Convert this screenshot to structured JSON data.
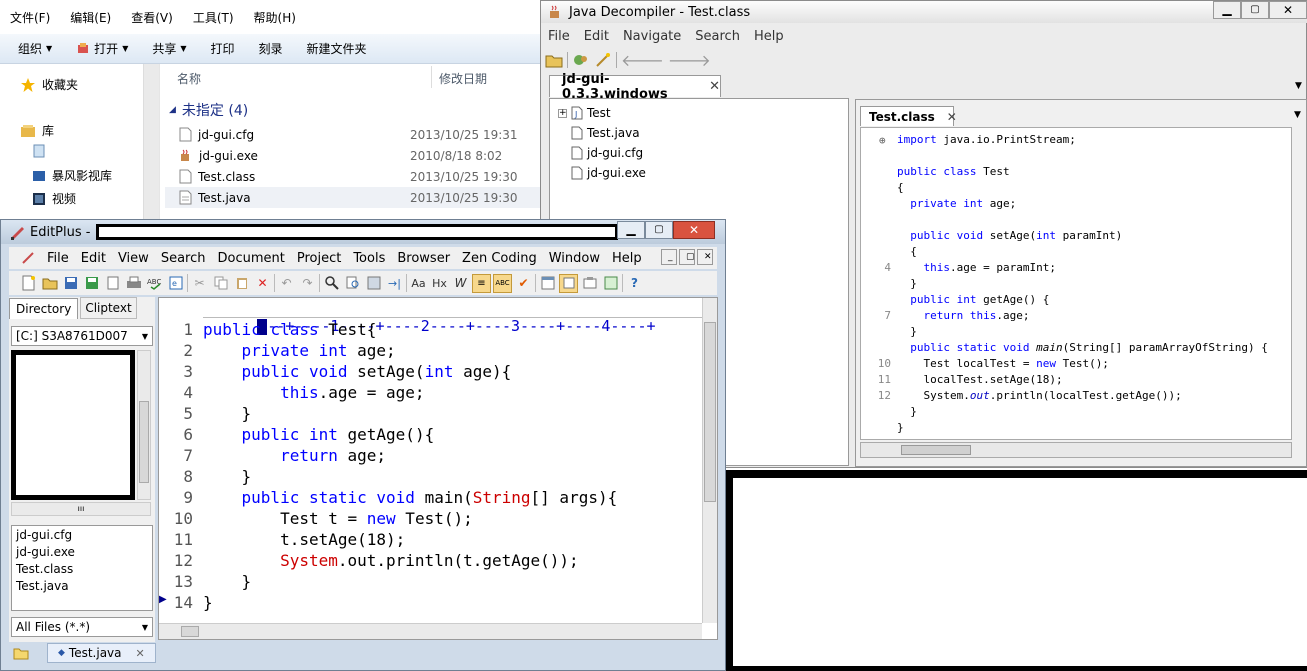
{
  "explorer": {
    "menu": [
      "文件(F)",
      "编辑(E)",
      "查看(V)",
      "工具(T)",
      "帮助(H)"
    ],
    "toolbar": {
      "organize": "组织",
      "open": "打开",
      "share": "共享",
      "print": "打印",
      "burn": "刻录",
      "new_folder": "新建文件夹"
    },
    "nav": {
      "favorites": "收藏夹",
      "library": "库",
      "media": "暴风影视库",
      "video": "视频"
    },
    "columns": {
      "name": "名称",
      "date": "修改日期"
    },
    "group": "未指定 (4)",
    "files": [
      {
        "name": "jd-gui.cfg",
        "date": "2013/10/25 19:31"
      },
      {
        "name": "jd-gui.exe",
        "date": "2010/8/18 8:02"
      },
      {
        "name": "Test.class",
        "date": "2013/10/25 19:30"
      },
      {
        "name": "Test.java",
        "date": "2013/10/25 19:30"
      }
    ]
  },
  "jd": {
    "title": "Java Decompiler - Test.class",
    "menu": [
      "File",
      "Edit",
      "Navigate",
      "Search",
      "Help"
    ],
    "tab": "jd-gui-0.3.3.windows",
    "tree": [
      "Test",
      "Test.java",
      "jd-gui.cfg",
      "jd-gui.exe"
    ],
    "code_tab": "Test.class",
    "code": [
      {
        "n": "",
        "t": "import java.io.PrintStream;"
      },
      {
        "n": "",
        "t": ""
      },
      {
        "n": "",
        "t": "public class Test"
      },
      {
        "n": "",
        "t": "{"
      },
      {
        "n": "",
        "t": "  private int age;"
      },
      {
        "n": "",
        "t": ""
      },
      {
        "n": "",
        "t": "  public void setAge(int paramInt)"
      },
      {
        "n": "",
        "t": "  {"
      },
      {
        "n": "4",
        "t": "    this.age = paramInt;"
      },
      {
        "n": "",
        "t": "  }"
      },
      {
        "n": "",
        "t": "  public int getAge() {"
      },
      {
        "n": "7",
        "t": "    return this.age;"
      },
      {
        "n": "",
        "t": "  }"
      },
      {
        "n": "",
        "t": "  public static void main(String[] paramArrayOfString) {"
      },
      {
        "n": "10",
        "t": "    Test localTest = new Test();"
      },
      {
        "n": "11",
        "t": "    localTest.setAge(18);"
      },
      {
        "n": "12",
        "t": "    System.out.println(localTest.getAge());"
      },
      {
        "n": "",
        "t": "  }"
      },
      {
        "n": "",
        "t": "}"
      }
    ]
  },
  "editplus": {
    "title": "EditPlus -",
    "menu": [
      "File",
      "Edit",
      "View",
      "Search",
      "Document",
      "Project",
      "Tools",
      "Browser",
      "Zen Coding",
      "Window",
      "Help"
    ],
    "tabs": {
      "directory": "Directory",
      "cliptext": "Cliptext"
    },
    "drive": "[C:] S3A8761D007",
    "files": [
      "jd-gui.cfg",
      "jd-gui.exe",
      "Test.class",
      "Test.java"
    ],
    "filter": "All Files (*.*)",
    "doc_tab": "Test.java",
    "ruler": "--+----1----+----2----+----3----+----4----+",
    "code": [
      {
        "n": "1",
        "t": "public class Test{"
      },
      {
        "n": "2",
        "t": "    private int age;"
      },
      {
        "n": "3",
        "t": "    public void setAge(int age){"
      },
      {
        "n": "4",
        "t": "        this.age = age;"
      },
      {
        "n": "5",
        "t": "    }"
      },
      {
        "n": "6",
        "t": "    public int getAge(){"
      },
      {
        "n": "7",
        "t": "        return age;"
      },
      {
        "n": "8",
        "t": "    }"
      },
      {
        "n": "9",
        "t": "    public static void main(String[] args){"
      },
      {
        "n": "10",
        "t": "        Test t = new Test();"
      },
      {
        "n": "11",
        "t": "        t.setAge(18);"
      },
      {
        "n": "12",
        "t": "        System.out.println(t.getAge());"
      },
      {
        "n": "13",
        "t": "    }"
      },
      {
        "n": "14",
        "t": "}"
      }
    ]
  }
}
